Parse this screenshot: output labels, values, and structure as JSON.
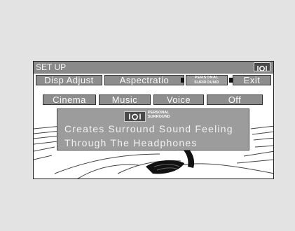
{
  "window": {
    "title": "SET UP",
    "icon": "personal-surround-icon"
  },
  "tabs": {
    "disp_adjust": "Disp Adjust",
    "aspectratio": "Aspectratio",
    "personal_surround_line1": "PERSONAL",
    "personal_surround_line2": "SURROUND",
    "exit": "Exit"
  },
  "options": {
    "cinema": "Cinema",
    "music": "Music",
    "voice": "Voice",
    "off": "Off"
  },
  "info": {
    "label_line1": "PERSONAL",
    "label_line2": "SURROUND",
    "line1": "Creates Surround Sound Feeling",
    "line2": "Through The Headphones"
  },
  "colors": {
    "page_bg": "#e3e3e3",
    "panel": "#8d8d8d",
    "text": "#fafafa"
  }
}
